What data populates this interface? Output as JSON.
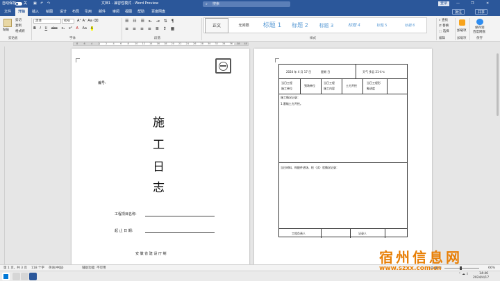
{
  "titlebar": {
    "autosave_label": "自动保存",
    "autosave_state": "关",
    "doc_title": "文档1 - 兼容性模式 - Word Preview",
    "search_placeholder": "搜索",
    "account_button": "登录"
  },
  "tabs": [
    "文件",
    "开始",
    "插入",
    "绘图",
    "设计",
    "布局",
    "引用",
    "邮件",
    "审阅",
    "视图",
    "帮助",
    "百度网盘"
  ],
  "active_tab": "开始",
  "tab_actions": {
    "comments": "批注",
    "share": "共享"
  },
  "ribbon": {
    "clipboard": {
      "paste": "粘贴",
      "cut": "剪切",
      "copy": "复制",
      "format_painter": "格式刷",
      "group": "剪贴板"
    },
    "font": {
      "font_name": "黑体",
      "font_size": "初号",
      "group": "字体",
      "buttons": [
        "B",
        "I",
        "U",
        "abc",
        "x₂",
        "x²",
        "A",
        "Aa",
        "A"
      ]
    },
    "paragraph": {
      "group": "段落"
    },
    "styles": {
      "group": "样式",
      "items": [
        "正文",
        "无间隔",
        "标题 1",
        "标题 2",
        "标题 3",
        "标题 4",
        "标题 5",
        "标题 6"
      ],
      "colors": [
        "#333333",
        "#333333",
        "#5b9bd5",
        "#5b9bd5",
        "#5b9bd5",
        "#5b9bd5",
        "#5b9bd5",
        "#5b9bd5"
      ]
    },
    "editing": {
      "find": "查找",
      "replace": "替换",
      "select": "选择",
      "group": "编辑"
    },
    "addins": {
      "label": "加载项",
      "group": "加载项"
    },
    "save_to_cloud": {
      "label1": "保存到",
      "label2": "百度网盘",
      "group": "保存"
    }
  },
  "ruler_numbers": [
    "8",
    "6",
    "4",
    "2",
    "2",
    "4",
    "6",
    "8",
    "10",
    "12",
    "14",
    "16",
    "18",
    "20",
    "22",
    "24",
    "26",
    "28",
    "30",
    "32",
    "34",
    "36",
    "38",
    "40"
  ],
  "page1": {
    "number_label": "编号:",
    "title_chars": [
      "施",
      "工",
      "日",
      "志"
    ],
    "project_name_label": "工程项目名称:",
    "date_range_label": "起  止  日  期:",
    "issuer": "安  徽  省  建  设  厅  制"
  },
  "page2": {
    "date_text": "2024 年 4 月 17 日",
    "weekday_text": "星期  日",
    "weather_text": "天气  多云 21-4℃",
    "h_cols": [
      "当日工程\n施工单位",
      "到场单位",
      "当日工程\n施工内容",
      "土方开挖",
      "当日工程形\n象进度"
    ],
    "construction_record_label": "施工情况记录：",
    "construction_record_item": "1.基础土方开挖。",
    "material_label": "当日材料、构配件进场、检（试）验情况记录：",
    "responsible_label": "工程负责人",
    "recorder_label": "记录人"
  },
  "statusbar": {
    "page": "第 1 页，共 3 页",
    "words": "118 个字",
    "lang": "英语(中国)",
    "accessibility": "辅助功能: 不可用",
    "zoom": "66%"
  },
  "taskbar": {
    "date": "2024/4/17",
    "time": "14:46"
  },
  "watermark": {
    "line1": "宿州信息网",
    "line2": "www.szxx.com.cn"
  },
  "accent_color": "#2b579a"
}
